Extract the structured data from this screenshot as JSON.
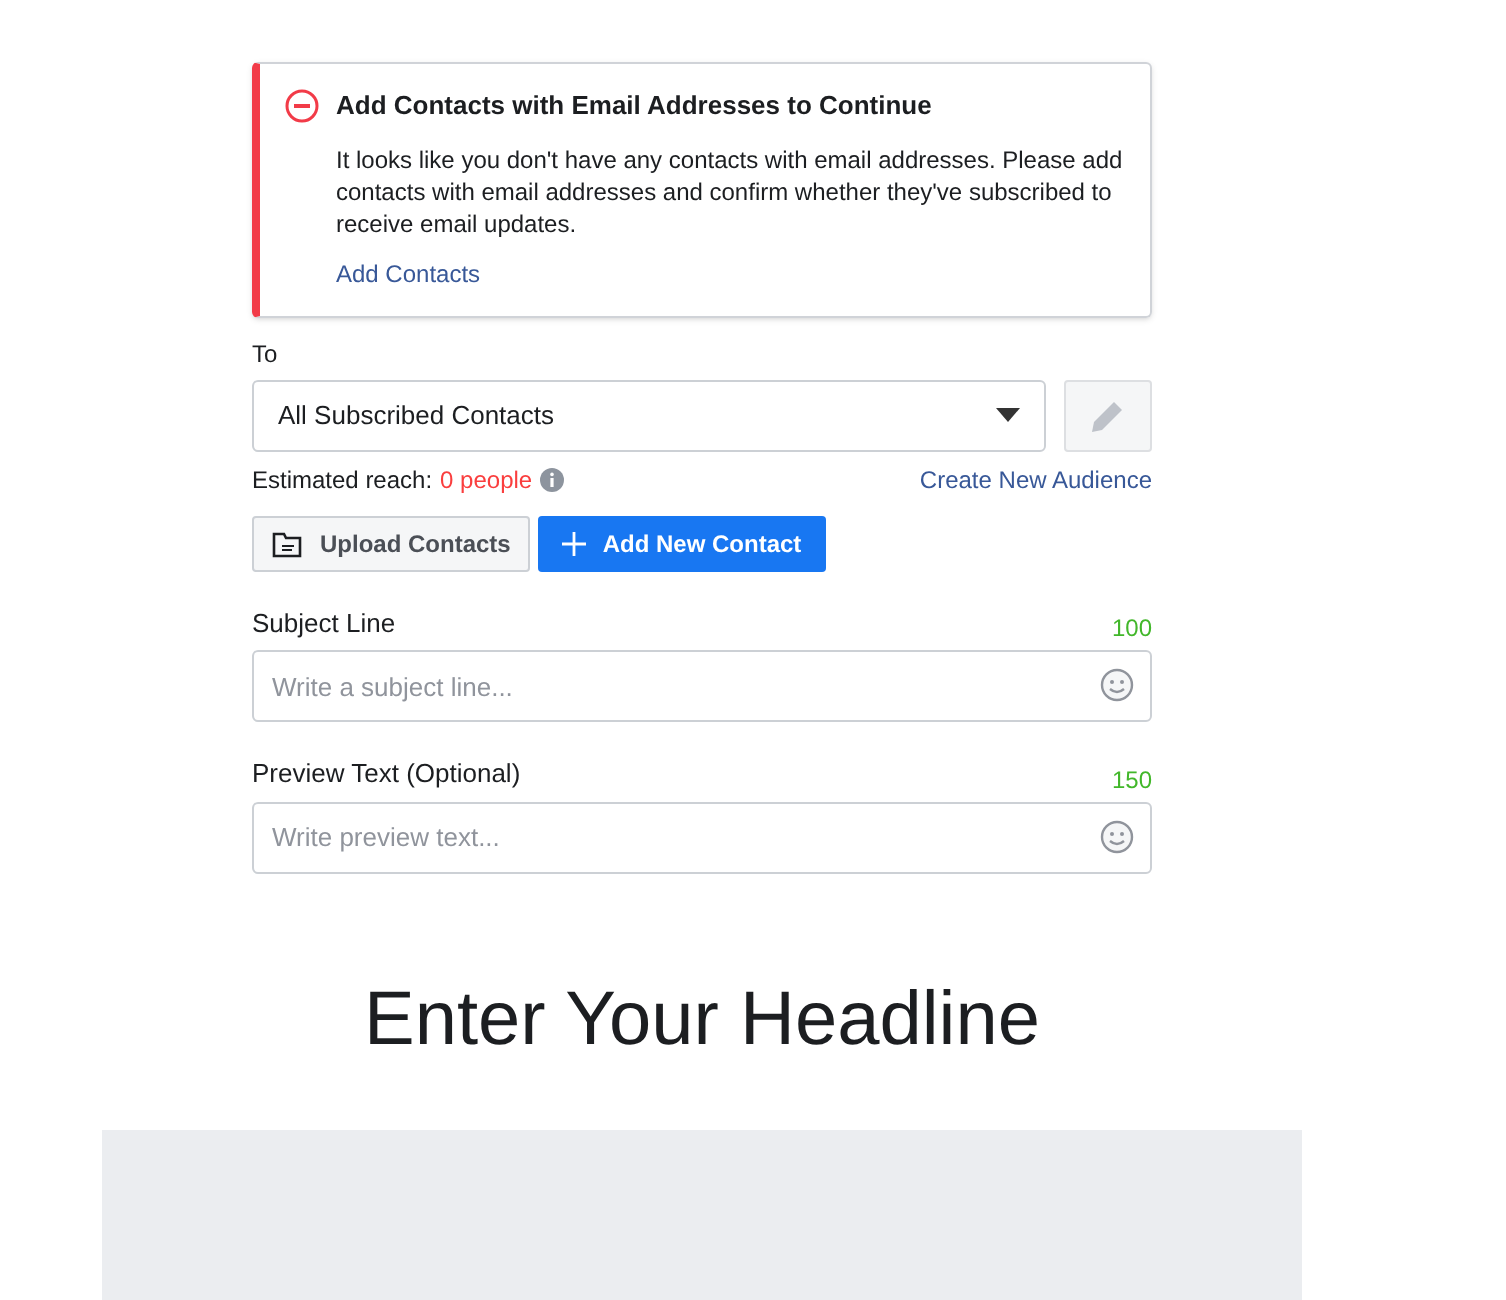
{
  "alert": {
    "title": "Add Contacts with Email Addresses to Continue",
    "message": "It looks like you don't have any contacts with email addresses. Please add contacts with email addresses and confirm whether they've subscribed to receive email updates.",
    "link": "Add Contacts"
  },
  "to": {
    "label": "To",
    "value": "All Subscribed Contacts",
    "edit_disabled": true
  },
  "reach": {
    "label": "Estimated reach:",
    "value": "0 people",
    "link": "Create New Audience"
  },
  "buttons": [
    {
      "label": "Upload Contacts",
      "kind": "secondary"
    },
    {
      "label": "Add New Contact",
      "kind": "primary"
    }
  ],
  "fields": [
    {
      "label": "Subject Line",
      "counter": "100",
      "placeholder": "Write a subject line..."
    },
    {
      "label": "Preview Text (Optional)",
      "counter": "150",
      "placeholder": "Write preview text..."
    }
  ],
  "headline": "Enter Your Headline"
}
